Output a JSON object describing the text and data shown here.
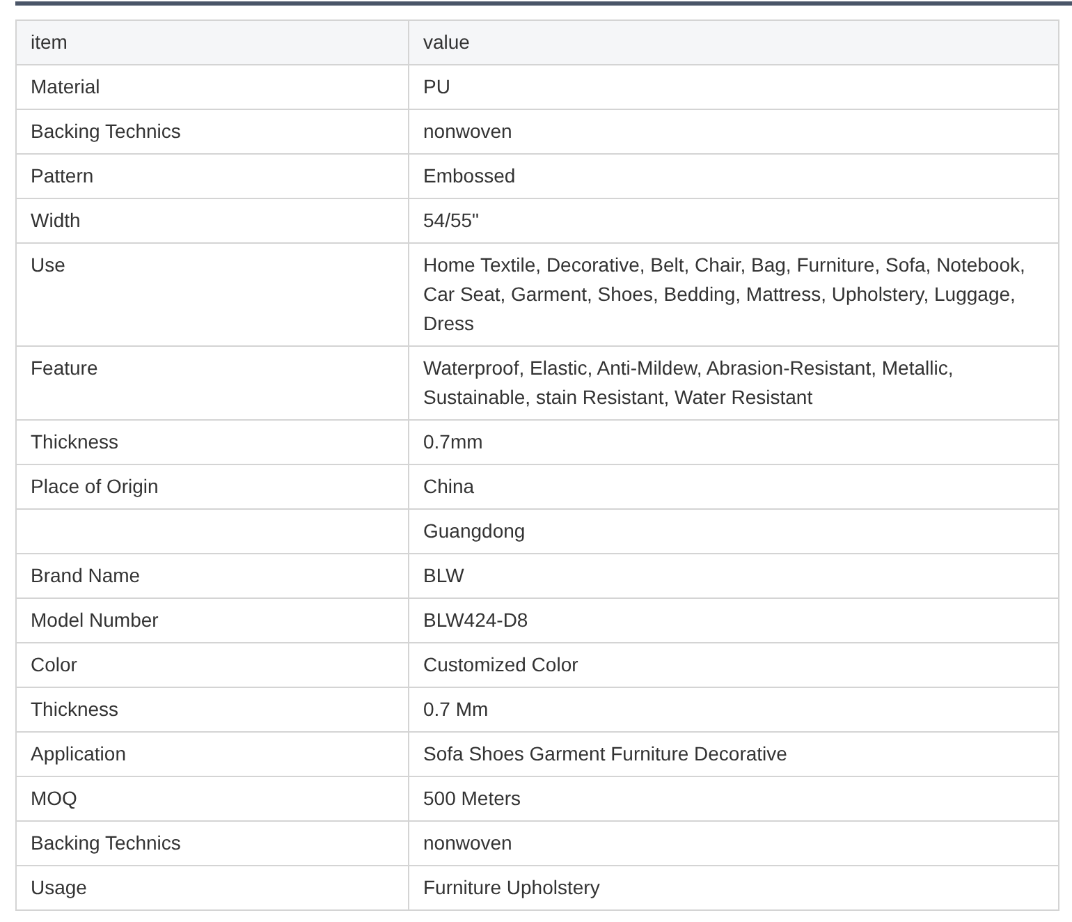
{
  "table": {
    "columns": [
      "item",
      "value"
    ],
    "rows": [
      {
        "item": "Material",
        "value": "PU"
      },
      {
        "item": "Backing Technics",
        "value": "nonwoven"
      },
      {
        "item": "Pattern",
        "value": "Embossed"
      },
      {
        "item": "Width",
        "value": "54/55\""
      },
      {
        "item": "Use",
        "value": "Home Textile, Decorative, Belt, Chair, Bag, Furniture, Sofa, Notebook, Car Seat, Garment, Shoes, Bedding, Mattress, Upholstery, Luggage, Dress"
      },
      {
        "item": "Feature",
        "value": "Waterproof, Elastic, Anti-Mildew, Abrasion-Resistant, Metallic, Sustainable, stain Resistant, Water Resistant"
      },
      {
        "item": "Thickness",
        "value": "0.7mm"
      },
      {
        "item": "Place of Origin",
        "value": "China"
      },
      {
        "value": "Guangdong"
      },
      {
        "item": "Brand Name",
        "value": "BLW"
      },
      {
        "item": "Model Number",
        "value": "BLW424-D8"
      },
      {
        "item": "Color",
        "value": "Customized Color"
      },
      {
        "item": "Thickness",
        "value": "0.7 Mm"
      },
      {
        "item": "Application",
        "value": "Sofa Shoes Garment Furniture Decorative"
      },
      {
        "item": "MOQ",
        "value": "500 Meters"
      },
      {
        "item": "Backing Technics",
        "value": "nonwoven"
      },
      {
        "item": "Usage",
        "value": "Furniture Upholstery"
      }
    ]
  }
}
